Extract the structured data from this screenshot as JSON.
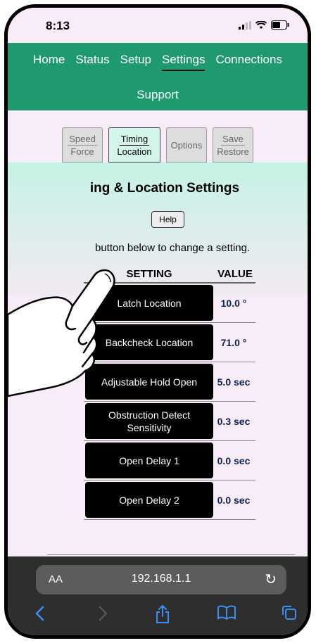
{
  "status_bar": {
    "time": "8:13"
  },
  "nav": {
    "items": [
      {
        "label": "Home"
      },
      {
        "label": "Status"
      },
      {
        "label": "Setup"
      },
      {
        "label": "Settings"
      },
      {
        "label": "Connections"
      }
    ],
    "support": "Support"
  },
  "subtabs": [
    {
      "line1": "Speed",
      "line2": "Force"
    },
    {
      "line1": "Timing",
      "line2": "Location"
    },
    {
      "line1": "Options",
      "line2": ""
    },
    {
      "line1": "Save",
      "line2": "Restore"
    }
  ],
  "page": {
    "title": "ing & Location Settings",
    "help_label": "Help",
    "instruction": "button below to change a setting."
  },
  "table": {
    "headers": {
      "setting": "SETTING",
      "value": "VALUE"
    },
    "rows": [
      {
        "setting": "Latch Location",
        "value": "10.0 °"
      },
      {
        "setting": "Backcheck Location",
        "value": "71.0 °"
      },
      {
        "setting": "Adjustable Hold Open",
        "value": "5.0 sec"
      },
      {
        "setting": "Obstruction Detect Sensitivity",
        "value": "0.3 sec"
      },
      {
        "setting": "Open Delay 1",
        "value": "0.0 sec"
      },
      {
        "setting": "Open Delay 2",
        "value": "0.0 sec"
      }
    ]
  },
  "browser": {
    "text_size_label": "AA",
    "url": "192.168.1.1"
  },
  "colors": {
    "nav_bg": "#1f9a6e",
    "page_bg": "#f8ecf8",
    "value_text": "#0c2150",
    "toolbar_accent": "#3b8ff0"
  }
}
